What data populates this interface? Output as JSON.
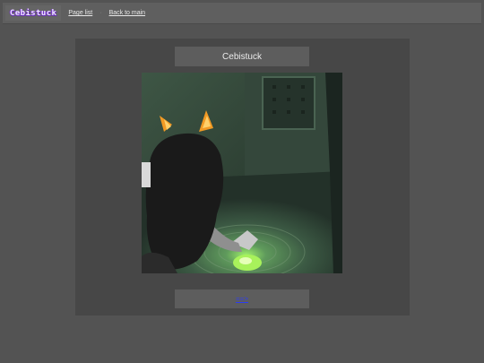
{
  "header": {
    "logo_text": "Cebistuck",
    "page_list_label": "Page list",
    "separator": "·",
    "back_label": "Back to main"
  },
  "page": {
    "title": "Cebistuck",
    "next_label": "==>"
  },
  "colors": {
    "background": "#535353",
    "panel": "#474747",
    "bar": "#5d5d5d",
    "link": "#2c3cf5",
    "logo_purple": "#7c3ad1"
  }
}
